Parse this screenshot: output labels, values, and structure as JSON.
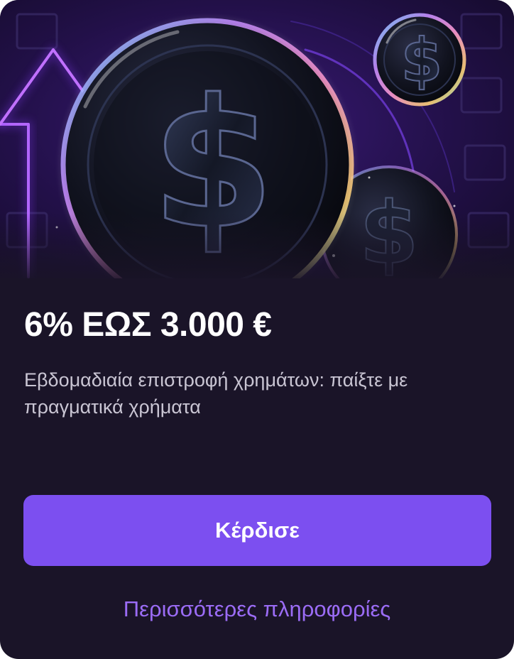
{
  "promo": {
    "hero_icon": "dollar-coin-bubbles",
    "title": "6% ΕΩΣ 3.000 €",
    "description": "Εβδομαδιαία επιστροφή χρημάτων: παίξτε με πραγματικά χρήματα",
    "cta_label": "Κέρδισε",
    "more_info_label": "Περισσότερες πληροφορίες"
  },
  "colors": {
    "card_background": "#1a1428",
    "accent": "#7c4ff0",
    "link": "#9b6cf6",
    "title_text": "#ffffff",
    "body_text": "#c9c5d3"
  }
}
